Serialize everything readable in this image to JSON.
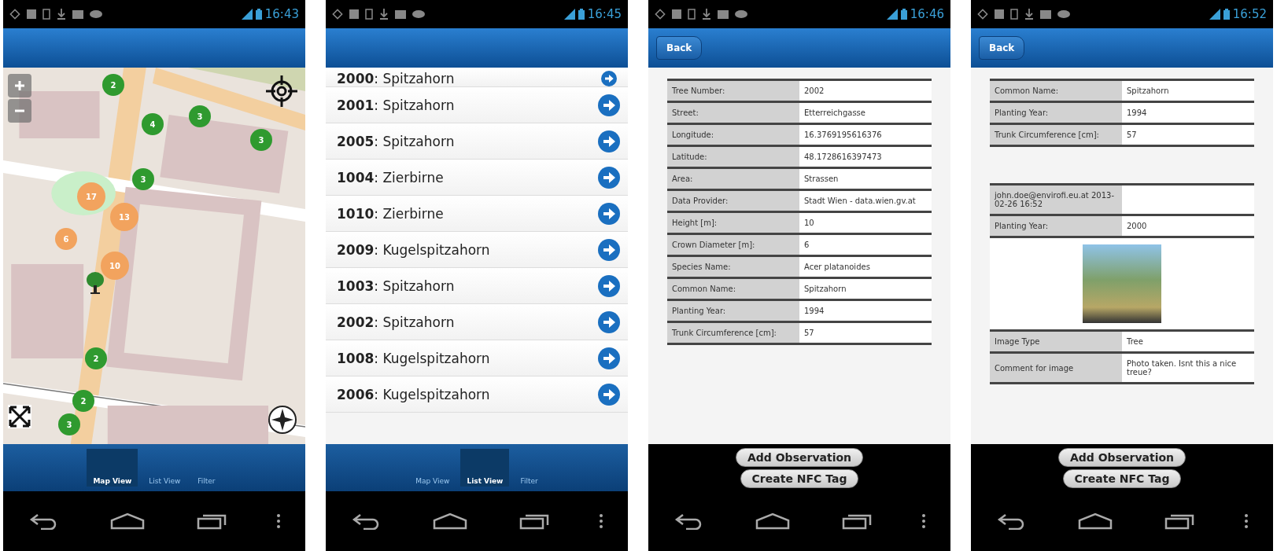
{
  "phones": [
    {
      "kind": "map",
      "time": "16:43",
      "markers": [
        {
          "label": "2",
          "color": "#2f9a2f"
        },
        {
          "label": "4",
          "color": "#2f9a2f"
        },
        {
          "label": "3",
          "color": "#2f9a2f"
        },
        {
          "label": "3",
          "color": "#2f9a2f"
        },
        {
          "label": "3",
          "color": "#2f9a2f"
        },
        {
          "label": "17",
          "color": "#f2a35e"
        },
        {
          "label": "13",
          "color": "#f2a35e"
        },
        {
          "label": "6",
          "color": "#f2a35e"
        },
        {
          "label": "10",
          "color": "#f2a35e"
        },
        {
          "label": "2",
          "color": "#2f9a2f"
        },
        {
          "label": "2",
          "color": "#2f9a2f"
        },
        {
          "label": "3",
          "color": "#2f9a2f"
        }
      ],
      "tabs": [
        {
          "label": "Map View",
          "selected": true
        },
        {
          "label": "List View",
          "selected": false
        },
        {
          "label": "Filter",
          "selected": false
        }
      ]
    },
    {
      "kind": "list",
      "time": "16:45",
      "items": [
        "**2000**: Spitzahorn",
        "**2001**: Spitzahorn",
        "**2005**: Spitzahorn",
        "**1004**: Zierbirne",
        "**1010**: Zierbirne",
        "**2009**: Kugelspitzahorn",
        "**1003**: Spitzahorn",
        "**2002**: Spitzahorn",
        "**1008**: Kugelspitzahorn",
        "**2006**: Kugelspitzahorn"
      ],
      "tabs": [
        {
          "label": "Map View",
          "selected": false
        },
        {
          "label": "List View",
          "selected": true
        },
        {
          "label": "Filter",
          "selected": false
        }
      ]
    },
    {
      "kind": "detail",
      "time": "16:46",
      "back": "Back",
      "rows": [
        {
          "kind": "field",
          "label": "Tree Number:",
          "value": "2002"
        },
        {
          "kind": "field",
          "label": "Street:",
          "value": "Etterreichgasse"
        },
        {
          "kind": "field",
          "label": "Longitude:",
          "value": "16.3769195616376"
        },
        {
          "kind": "field",
          "label": "Latitude:",
          "value": "48.1728616397473"
        },
        {
          "kind": "field",
          "label": "Area:",
          "value": "Strassen"
        },
        {
          "kind": "field",
          "label": "Data Provider:",
          "value": "Stadt Wien - data.wien.gv.at"
        },
        {
          "kind": "field",
          "label": "Height [m]:",
          "value": "10"
        },
        {
          "kind": "field",
          "label": "Crown Diameter [m]:",
          "value": "6"
        },
        {
          "kind": "field",
          "label": "Species Name:",
          "value": "Acer platanoides"
        },
        {
          "kind": "field",
          "label": "Common Name:",
          "value": "Spitzahorn"
        },
        {
          "kind": "field",
          "label": "Planting Year:",
          "value": "1994"
        },
        {
          "kind": "field",
          "label": "Trunk Circumference [cm]:",
          "value": "57"
        }
      ],
      "buttons": [
        "Add Observation",
        "Create NFC Tag"
      ]
    },
    {
      "kind": "detail",
      "time": "16:52",
      "back": "Back",
      "rows": [
        {
          "kind": "field",
          "label": "Common Name:",
          "value": "Spitzahorn"
        },
        {
          "kind": "field",
          "label": "Planting Year:",
          "value": "1994"
        },
        {
          "kind": "field",
          "label": "Trunk Circumference [cm]:",
          "value": "57"
        },
        {
          "kind": "gap"
        },
        {
          "kind": "field",
          "label": "john.doe@envirofi.eu.at 2013-02-26 16:52"
        },
        {
          "kind": "field",
          "label": "Planting Year:",
          "value": "2000"
        },
        {
          "kind": "photo"
        },
        {
          "kind": "field",
          "label": "Image Type",
          "value": "Tree"
        },
        {
          "kind": "field",
          "label": "Comment for image",
          "value": "Photo taken. Isnt this a nice treue?"
        }
      ],
      "buttons": [
        "Add Observation",
        "Create NFC Tag"
      ]
    }
  ]
}
